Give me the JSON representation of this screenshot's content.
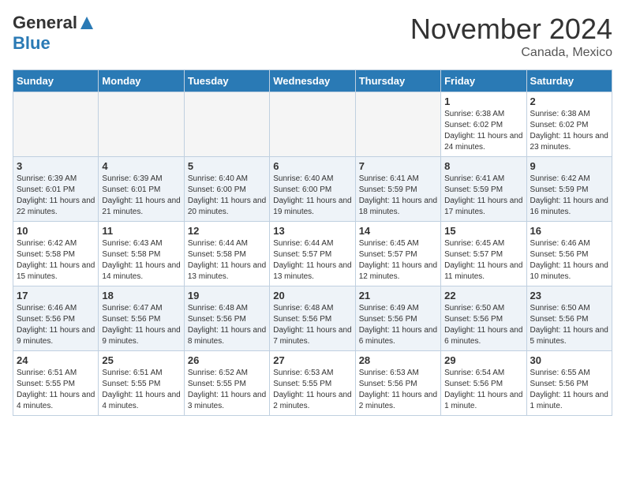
{
  "header": {
    "logo": {
      "general": "General",
      "blue": "Blue"
    },
    "month": "November 2024",
    "location": "Canada, Mexico"
  },
  "days_of_week": [
    "Sunday",
    "Monday",
    "Tuesday",
    "Wednesday",
    "Thursday",
    "Friday",
    "Saturday"
  ],
  "weeks": [
    [
      {
        "day": "",
        "info": ""
      },
      {
        "day": "",
        "info": ""
      },
      {
        "day": "",
        "info": ""
      },
      {
        "day": "",
        "info": ""
      },
      {
        "day": "",
        "info": ""
      },
      {
        "day": "1",
        "info": "Sunrise: 6:38 AM\nSunset: 6:02 PM\nDaylight: 11 hours and 24 minutes."
      },
      {
        "day": "2",
        "info": "Sunrise: 6:38 AM\nSunset: 6:02 PM\nDaylight: 11 hours and 23 minutes."
      }
    ],
    [
      {
        "day": "3",
        "info": "Sunrise: 6:39 AM\nSunset: 6:01 PM\nDaylight: 11 hours and 22 minutes."
      },
      {
        "day": "4",
        "info": "Sunrise: 6:39 AM\nSunset: 6:01 PM\nDaylight: 11 hours and 21 minutes."
      },
      {
        "day": "5",
        "info": "Sunrise: 6:40 AM\nSunset: 6:00 PM\nDaylight: 11 hours and 20 minutes."
      },
      {
        "day": "6",
        "info": "Sunrise: 6:40 AM\nSunset: 6:00 PM\nDaylight: 11 hours and 19 minutes."
      },
      {
        "day": "7",
        "info": "Sunrise: 6:41 AM\nSunset: 5:59 PM\nDaylight: 11 hours and 18 minutes."
      },
      {
        "day": "8",
        "info": "Sunrise: 6:41 AM\nSunset: 5:59 PM\nDaylight: 11 hours and 17 minutes."
      },
      {
        "day": "9",
        "info": "Sunrise: 6:42 AM\nSunset: 5:59 PM\nDaylight: 11 hours and 16 minutes."
      }
    ],
    [
      {
        "day": "10",
        "info": "Sunrise: 6:42 AM\nSunset: 5:58 PM\nDaylight: 11 hours and 15 minutes."
      },
      {
        "day": "11",
        "info": "Sunrise: 6:43 AM\nSunset: 5:58 PM\nDaylight: 11 hours and 14 minutes."
      },
      {
        "day": "12",
        "info": "Sunrise: 6:44 AM\nSunset: 5:58 PM\nDaylight: 11 hours and 13 minutes."
      },
      {
        "day": "13",
        "info": "Sunrise: 6:44 AM\nSunset: 5:57 PM\nDaylight: 11 hours and 13 minutes."
      },
      {
        "day": "14",
        "info": "Sunrise: 6:45 AM\nSunset: 5:57 PM\nDaylight: 11 hours and 12 minutes."
      },
      {
        "day": "15",
        "info": "Sunrise: 6:45 AM\nSunset: 5:57 PM\nDaylight: 11 hours and 11 minutes."
      },
      {
        "day": "16",
        "info": "Sunrise: 6:46 AM\nSunset: 5:56 PM\nDaylight: 11 hours and 10 minutes."
      }
    ],
    [
      {
        "day": "17",
        "info": "Sunrise: 6:46 AM\nSunset: 5:56 PM\nDaylight: 11 hours and 9 minutes."
      },
      {
        "day": "18",
        "info": "Sunrise: 6:47 AM\nSunset: 5:56 PM\nDaylight: 11 hours and 9 minutes."
      },
      {
        "day": "19",
        "info": "Sunrise: 6:48 AM\nSunset: 5:56 PM\nDaylight: 11 hours and 8 minutes."
      },
      {
        "day": "20",
        "info": "Sunrise: 6:48 AM\nSunset: 5:56 PM\nDaylight: 11 hours and 7 minutes."
      },
      {
        "day": "21",
        "info": "Sunrise: 6:49 AM\nSunset: 5:56 PM\nDaylight: 11 hours and 6 minutes."
      },
      {
        "day": "22",
        "info": "Sunrise: 6:50 AM\nSunset: 5:56 PM\nDaylight: 11 hours and 6 minutes."
      },
      {
        "day": "23",
        "info": "Sunrise: 6:50 AM\nSunset: 5:56 PM\nDaylight: 11 hours and 5 minutes."
      }
    ],
    [
      {
        "day": "24",
        "info": "Sunrise: 6:51 AM\nSunset: 5:55 PM\nDaylight: 11 hours and 4 minutes."
      },
      {
        "day": "25",
        "info": "Sunrise: 6:51 AM\nSunset: 5:55 PM\nDaylight: 11 hours and 4 minutes."
      },
      {
        "day": "26",
        "info": "Sunrise: 6:52 AM\nSunset: 5:55 PM\nDaylight: 11 hours and 3 minutes."
      },
      {
        "day": "27",
        "info": "Sunrise: 6:53 AM\nSunset: 5:55 PM\nDaylight: 11 hours and 2 minutes."
      },
      {
        "day": "28",
        "info": "Sunrise: 6:53 AM\nSunset: 5:56 PM\nDaylight: 11 hours and 2 minutes."
      },
      {
        "day": "29",
        "info": "Sunrise: 6:54 AM\nSunset: 5:56 PM\nDaylight: 11 hours and 1 minute."
      },
      {
        "day": "30",
        "info": "Sunrise: 6:55 AM\nSunset: 5:56 PM\nDaylight: 11 hours and 1 minute."
      }
    ]
  ]
}
